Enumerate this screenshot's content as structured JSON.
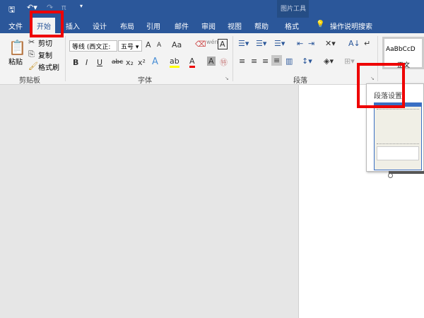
{
  "quick_access": {
    "save_icon": "save-icon",
    "undo_icon": "undo-icon",
    "redo_icon": "redo-icon",
    "pi_label": "π"
  },
  "context_tab_group": "图片工具",
  "tabs": [
    "文件",
    "开始",
    "插入",
    "设计",
    "布局",
    "引用",
    "邮件",
    "审阅",
    "视图",
    "帮助",
    "格式"
  ],
  "search_label": "操作说明搜索",
  "clipboard": {
    "paste": "粘贴",
    "cut": "剪切",
    "copy": "复制",
    "format_painter": "格式刷",
    "group": "剪贴板"
  },
  "font": {
    "name": "等线 (西文正:",
    "size": "五号",
    "grow": "A",
    "shrink": "A",
    "case": "Aa",
    "bold": "B",
    "italic": "I",
    "underline": "U",
    "strike": "abc",
    "sub": "x₂",
    "sup": "x²",
    "group": "字体"
  },
  "paragraph": {
    "group": "段落"
  },
  "styles": {
    "preview": "AaBbCcD",
    "name": "正文"
  },
  "tooltip": {
    "title": "段落设置"
  },
  "colors": {
    "accent": "#2b579a",
    "highlight": "#ffff00",
    "font_color": "#e00000",
    "callout": "#e00000"
  }
}
